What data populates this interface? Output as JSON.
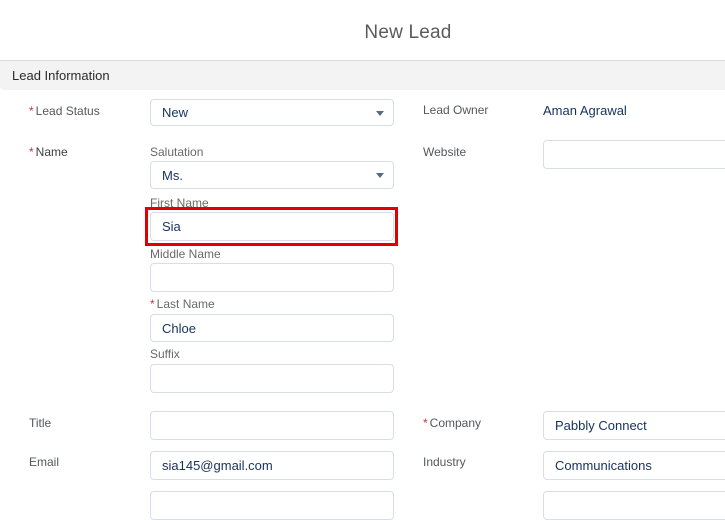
{
  "page": {
    "title": "New Lead"
  },
  "section": {
    "title": "Lead Information"
  },
  "fields": {
    "lead_status": {
      "label": "Lead Status",
      "required": "*",
      "value": "New"
    },
    "lead_owner": {
      "label": "Lead Owner",
      "value": "Aman Agrawal"
    },
    "name": {
      "label": "Name",
      "required": "*"
    },
    "salutation": {
      "label": "Salutation",
      "value": "Ms."
    },
    "first_name": {
      "label": "First Name",
      "value": "Sia"
    },
    "middle_name": {
      "label": "Middle Name",
      "value": ""
    },
    "last_name": {
      "label": "Last Name",
      "required": "*",
      "value": "Chloe"
    },
    "suffix": {
      "label": "Suffix",
      "value": ""
    },
    "website": {
      "label": "Website",
      "value": ""
    },
    "title": {
      "label": "Title",
      "value": ""
    },
    "company": {
      "label": "Company",
      "required": "*",
      "value": "Pabbly Connect"
    },
    "email": {
      "label": "Email",
      "value": "sia145@gmail.com"
    },
    "industry": {
      "label": "Industry",
      "value": "Communications"
    }
  },
  "colors": {
    "required": "#c23934",
    "highlight": "#e00000",
    "section_bg": "#f3f3f3"
  }
}
